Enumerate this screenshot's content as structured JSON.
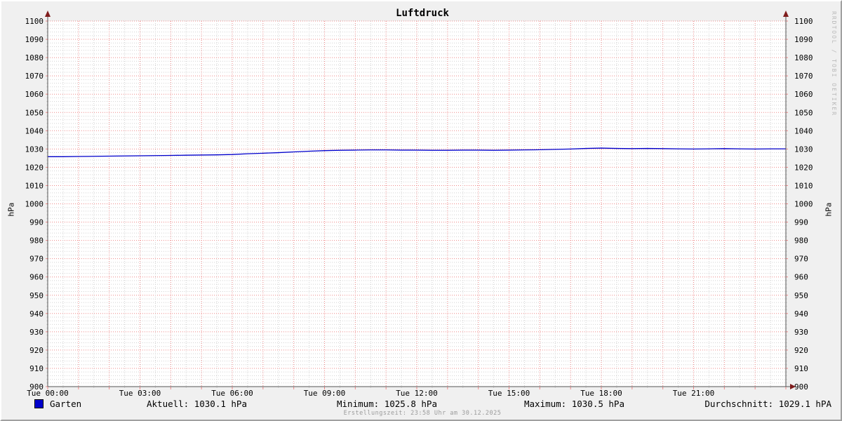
{
  "title": "Luftdruck",
  "watermark": "RRDTOOL / TOBI OETIKER",
  "axis": {
    "y_label_left": "hPa",
    "y_label_right": "hPa",
    "x_labels": [
      "Tue 00:00",
      "Tue 03:00",
      "Tue 06:00",
      "Tue 09:00",
      "Tue 12:00",
      "Tue 15:00",
      "Tue 18:00",
      "Tue 21:00"
    ],
    "x_tick_hours": [
      0,
      3,
      6,
      9,
      12,
      15,
      18,
      21
    ]
  },
  "legend": {
    "series_label": "Garten",
    "series_color": "#0000cc"
  },
  "stats": {
    "aktuell": "Aktuell: 1030.1 hPa",
    "minimum": "Minimum: 1025.8 hPa",
    "maximum": "Maximum: 1030.5 hPa",
    "durchschnitt": "Durchschnitt: 1029.1 hPA"
  },
  "footer": "Erstellungszeit: 23:58 Uhr am 30.12.2025",
  "colors": {
    "background": "#f0f0f0",
    "canvas": "#ffffff",
    "major_grid": "#ee8888",
    "minor_grid": "#d2d2d2",
    "axis": "#555555",
    "arrow": "#7f1d1d",
    "series": "#0000cc"
  },
  "chart_data": {
    "type": "line",
    "title": "Luftdruck",
    "xlabel": "",
    "ylabel": "hPa",
    "ylim": [
      900,
      1100
    ],
    "y_major_step": 10,
    "y_minor_step": 2,
    "xlim_hours": [
      0,
      24
    ],
    "x_major_step_minutes": 60,
    "x_minor_step_minutes": 30,
    "grid": true,
    "legend_position": "bottom-left",
    "x": [
      0,
      0.5,
      1,
      1.5,
      2,
      2.5,
      3,
      3.5,
      4,
      4.5,
      5,
      5.5,
      6,
      6.5,
      7,
      7.5,
      8,
      8.5,
      9,
      9.5,
      10,
      10.5,
      11,
      11.5,
      12,
      12.5,
      13,
      13.5,
      14,
      14.5,
      15,
      15.5,
      16,
      16.5,
      17,
      17.5,
      18,
      18.5,
      19,
      19.5,
      20,
      20.5,
      21,
      21.5,
      22,
      22.5,
      23,
      23.5,
      24
    ],
    "series": [
      {
        "name": "Garten",
        "color": "#0000cc",
        "values": [
          1025.8,
          1025.8,
          1025.9,
          1026.0,
          1026.1,
          1026.2,
          1026.3,
          1026.4,
          1026.5,
          1026.6,
          1026.7,
          1026.8,
          1027.0,
          1027.4,
          1027.7,
          1028.0,
          1028.4,
          1028.8,
          1029.1,
          1029.3,
          1029.4,
          1029.5,
          1029.5,
          1029.4,
          1029.4,
          1029.3,
          1029.3,
          1029.4,
          1029.4,
          1029.3,
          1029.4,
          1029.5,
          1029.6,
          1029.8,
          1030.0,
          1030.3,
          1030.5,
          1030.3,
          1030.2,
          1030.3,
          1030.2,
          1030.1,
          1030.0,
          1030.1,
          1030.2,
          1030.1,
          1030.0,
          1030.1,
          1030.1
        ]
      }
    ],
    "stats": {
      "aktuell_hpa": 1030.1,
      "minimum_hpa": 1025.8,
      "maximum_hpa": 1030.5,
      "durchschnitt_hpa": 1029.1
    }
  }
}
